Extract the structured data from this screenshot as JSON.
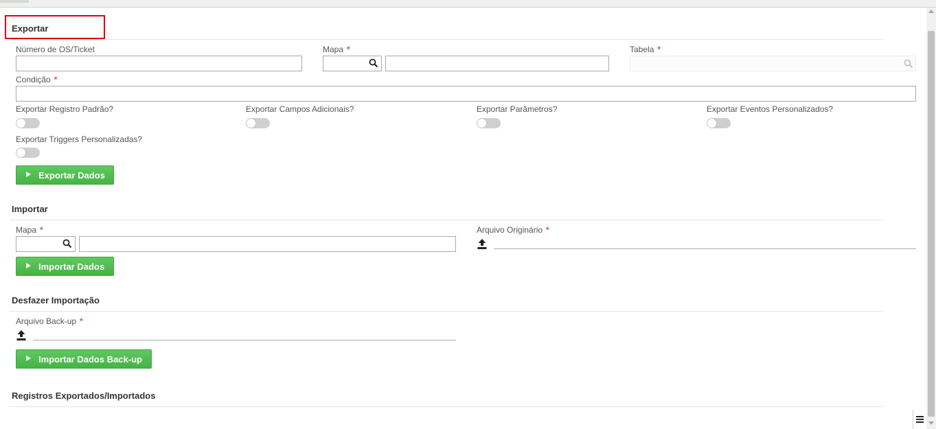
{
  "export": {
    "title": "Exportar",
    "os_ticket_label": "Número de OS/Ticket",
    "mapa_label": "Mapa",
    "tabela_label": "Tabela",
    "condicao_label": "Condição",
    "required_mark": "*",
    "toggles": [
      {
        "label": "Exportar Registro Padrão?"
      },
      {
        "label": "Exportar Campos Adicionais?"
      },
      {
        "label": "Exportar Parâmetros?"
      },
      {
        "label": "Exportar Eventos Personalizados?"
      },
      {
        "label": "Exportar Triggers Personalizadas?"
      }
    ],
    "button_label": "Exportar Dados"
  },
  "import": {
    "title": "Importar",
    "mapa_label": "Mapa",
    "arquivo_label": "Arquivo Originário",
    "button_label": "Importar Dados"
  },
  "undo": {
    "title": "Desfazer Importação",
    "arquivo_label": "Arquivo Back-up",
    "button_label": "Importar Dados Back-up"
  },
  "records": {
    "title": "Registros Exportados/Importados"
  },
  "icons": {
    "lookup": "search-icon",
    "upload": "upload-icon",
    "play": "play-icon",
    "menu": "hamburger-menu-icon"
  },
  "colors": {
    "button_green": "#4cbb4c",
    "required_red": "#d9534f",
    "highlight_red": "#e00000"
  }
}
